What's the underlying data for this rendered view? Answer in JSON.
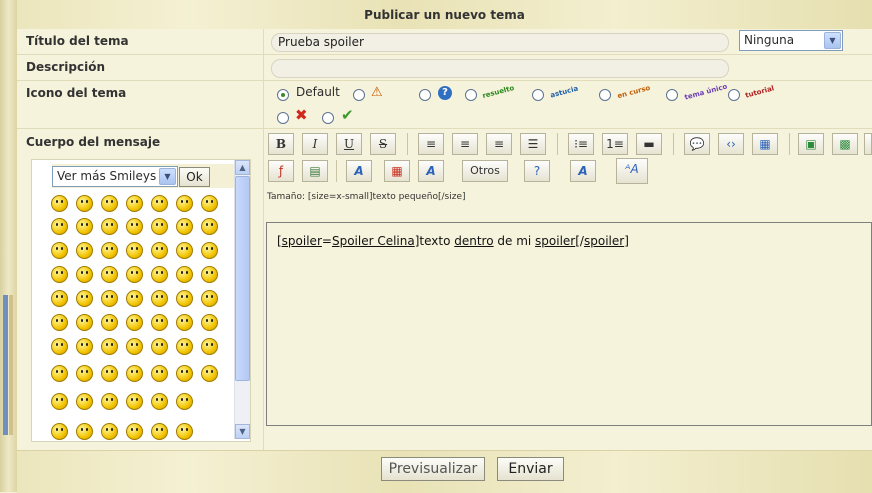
{
  "header": {
    "title": "Publicar un nuevo tema"
  },
  "fields": {
    "titulo_label": "Título del tema",
    "titulo_value": "Prueba spoiler",
    "titulo_select": "Ninguna",
    "descripcion_label": "Descripción",
    "descripcion_value": "",
    "icono_label": "Icono del tema",
    "icono_default": "Default",
    "cuerpo_label": "Cuerpo del mensaje"
  },
  "icon_tags": [
    "resuelto",
    "astucia",
    "en curso",
    "tema único",
    "tutorial"
  ],
  "toolbar": {
    "bold": "B",
    "italic": "I",
    "underline": "U",
    "strike": "S",
    "otros": "Otros",
    "hint": "Tamaño: [size=x-small]texto pequeño[/size]"
  },
  "smileys": {
    "select_value": "Ver más Smileys",
    "ok_label": "Ok"
  },
  "editor": {
    "content_parts": [
      "[spoiler",
      "=",
      "Spoiler Celina",
      "]texto ",
      "dentro",
      " de mi ",
      "spoiler",
      "[/",
      "spoiler",
      "]"
    ]
  },
  "footer": {
    "preview_label": "Previsualizar",
    "send_label": "Enviar"
  },
  "colors": {
    "accent": "#3a8a2a",
    "header_bg": "#ece6bd"
  }
}
